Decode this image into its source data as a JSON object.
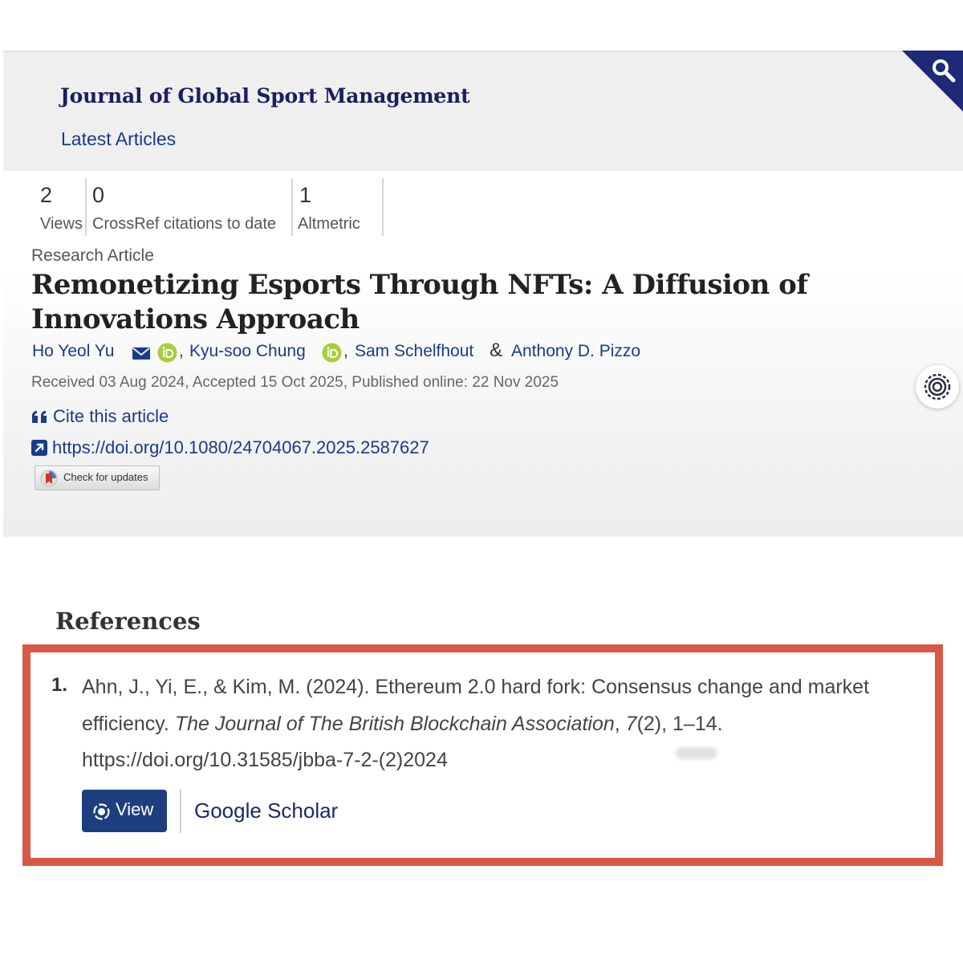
{
  "journal": {
    "title": "Journal of Global Sport Management",
    "chevron": "›",
    "latest_link": "Latest Articles"
  },
  "metrics": [
    {
      "value": "2",
      "label": "Views"
    },
    {
      "value": "0",
      "label": "CrossRef citations to date"
    },
    {
      "value": "1",
      "label": "Altmetric"
    }
  ],
  "article": {
    "type": "Research Article",
    "title": "Remonetizing Esports Through NFTs: A Diffusion of Innovations Approach",
    "authors": [
      {
        "name": "Ho Yeol Yu"
      },
      {
        "name": "Kyu-soo Chung"
      },
      {
        "name": "Sam Schelfhout"
      },
      {
        "name": "Anthony D. Pizzo"
      }
    ],
    "author_comma": ",",
    "author_ampersand": "&",
    "dates": "Received 03 Aug 2024, Accepted 15 Oct 2025, Published online: 22 Nov 2025",
    "cite_label": "Cite this article",
    "doi": "https://doi.org/10.1080/24704067.2025.2587627",
    "check_updates_label": "Check for updates"
  },
  "references": {
    "heading": "References",
    "items": [
      {
        "number": "1.",
        "text_before": "Ahn, J., Yi, E., & Kim, M. (2024). Ethereum 2.0 hard fork: Consensus change and market efficiency. ",
        "journal": "The Journal of The British Blockchain Association",
        "volume": "7",
        "after": "(2), 1–14.",
        "doi": "https://doi.org/10.31585/jbba-7-2-(2)2024",
        "view_label": "View",
        "scholar_label": "Google Scholar"
      }
    ]
  },
  "colors": {
    "brand_navy": "#1e2a78",
    "link_blue": "#1a3a8a",
    "highlight_red": "#d95843",
    "orcid_green": "#a6ce39",
    "view_button": "#1e3f7f"
  },
  "icons": [
    "search-icon",
    "mail-icon",
    "orcid-icon",
    "quote-icon",
    "external-link-icon",
    "crossmark-icon",
    "accessibility-icon",
    "view-icon"
  ]
}
